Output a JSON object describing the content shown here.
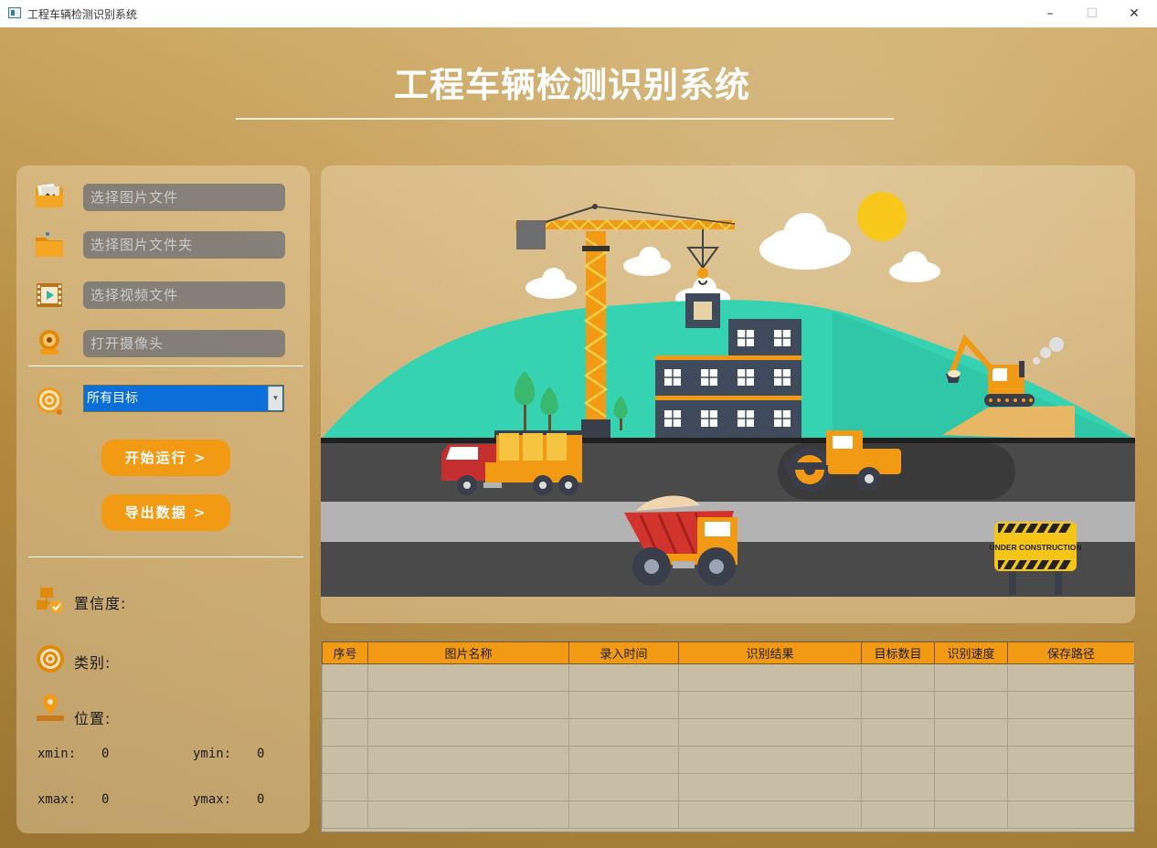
{
  "window": {
    "title": "工程车辆检测识别系统",
    "minimize": "–",
    "maximize": "☐",
    "close": "✕"
  },
  "header": {
    "title": "工程车辆检测识别系统"
  },
  "left": {
    "inputs": [
      {
        "placeholder": "选择图片文件"
      },
      {
        "placeholder": "选择图片文件夹"
      },
      {
        "placeholder": "选择视频文件"
      },
      {
        "placeholder": "打开摄像头"
      }
    ],
    "target_select": {
      "value": "所有目标",
      "arrow": "▾"
    },
    "start_button": "开始运行 >",
    "export_button": "导出数据 >",
    "confidence_label": "置信度:",
    "class_label": "类别:",
    "position_label": "位置:",
    "xmin_label": "xmin:",
    "xmin_value": "0",
    "ymin_label": "ymin:",
    "ymin_value": "0",
    "xmax_label": "xmax:",
    "xmax_value": "0",
    "ymax_label": "ymax:",
    "ymax_value": "0"
  },
  "scene": {
    "sign_text": "UNDER CONSTRUCTION"
  },
  "table": {
    "headers": [
      "序号",
      "图片名称",
      "录入时间",
      "识别结果",
      "目标数目",
      "识别速度",
      "保存路径"
    ],
    "rows": [
      [
        "",
        "",
        "",
        "",
        "",
        "",
        ""
      ],
      [
        "",
        "",
        "",
        "",
        "",
        "",
        ""
      ],
      [
        "",
        "",
        "",
        "",
        "",
        "",
        ""
      ],
      [
        "",
        "",
        "",
        "",
        "",
        "",
        ""
      ],
      [
        "",
        "",
        "",
        "",
        "",
        "",
        ""
      ],
      [
        "",
        "",
        "",
        "",
        "",
        "",
        ""
      ]
    ]
  },
  "colors": {
    "accent": "#f29a14",
    "select": "#0a6fd8",
    "teal": "#36d3b3",
    "road": "#4a4a4a"
  },
  "icons": [
    "image-file-icon",
    "folder-icon",
    "video-file-icon",
    "webcam-icon",
    "target-icon",
    "confidence-icon",
    "class-icon",
    "location-icon"
  ]
}
